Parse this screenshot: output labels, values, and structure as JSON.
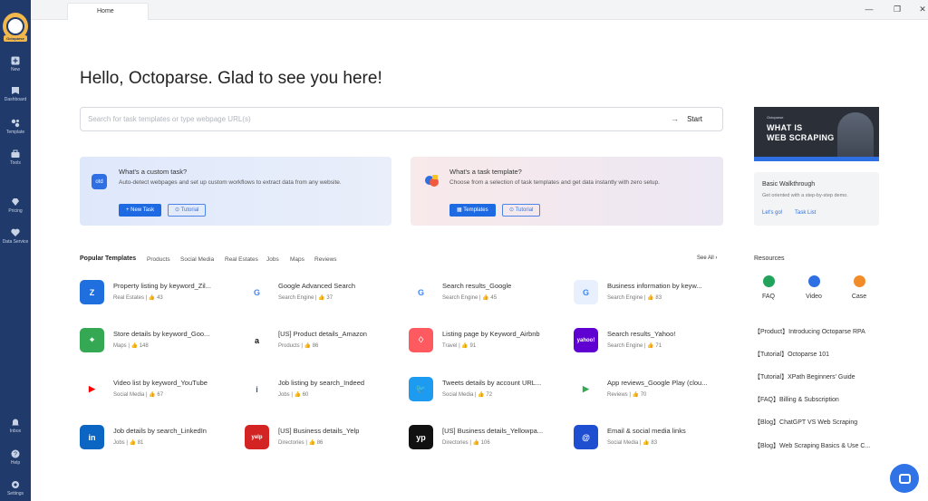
{
  "window": {
    "tab_label": "Home"
  },
  "sidebar": {
    "items": [
      {
        "label": "New",
        "icon": "plus-icon"
      },
      {
        "label": "Dashboard",
        "icon": "dashboard-icon"
      },
      {
        "label": "Template",
        "icon": "template-icon"
      },
      {
        "label": "Tools",
        "icon": "toolbox-icon"
      },
      {
        "label": "Pricing",
        "icon": "pricing-icon"
      },
      {
        "label": "Data Service",
        "icon": "data-service-icon"
      }
    ],
    "bottom_items": [
      {
        "label": "Inbox",
        "icon": "bell-icon"
      },
      {
        "label": "Help",
        "icon": "help-icon"
      },
      {
        "label": "Settings",
        "icon": "settings-icon"
      }
    ]
  },
  "main": {
    "greeting": "Hello, Octoparse. Glad to see you here!",
    "search": {
      "placeholder": "Search for task templates or type webpage URL(s)",
      "button_label": "Start"
    },
    "custom_card": {
      "title": "What's a custom task?",
      "description": "Auto-detect webpages and set up custom workflows to extract data from any website.",
      "primary_label": "+ New Task",
      "secondary_label": "Tutorial"
    },
    "template_card": {
      "title": "What's a task template?",
      "description": "Choose from a selection of task templates and get data instantly with zero setup.",
      "primary_label": "Templates",
      "secondary_label": "Tutorial"
    }
  },
  "popular": {
    "tabs": [
      "Popular Templates",
      "Products",
      "Social Media",
      "Real Estates",
      "Jobs",
      "Maps",
      "Reviews"
    ],
    "see_all": "See All",
    "templates": [
      {
        "name": "Property listing by keyword_Zil...",
        "category": "Real Estates",
        "likes": "43",
        "icon": "zillow-icon",
        "color": "#1f6fde",
        "glyph": "Z"
      },
      {
        "name": "Google Advanced Search",
        "category": "Search Engine",
        "likes": "37",
        "icon": "google-icon",
        "color": "#ffffff",
        "glyph": "G"
      },
      {
        "name": "Search results_Google",
        "category": "Search Engine",
        "likes": "45",
        "icon": "google-icon",
        "color": "#ffffff",
        "glyph": "G"
      },
      {
        "name": "Business information by keyw...",
        "category": "Search Engine",
        "likes": "83",
        "icon": "google-business-icon",
        "color": "#e8f0fd",
        "glyph": "G"
      },
      {
        "name": "Store details by keyword_Goo...",
        "category": "Maps",
        "likes": "148",
        "icon": "google-maps-icon",
        "color": "#34a853",
        "glyph": "⌖"
      },
      {
        "name": "[US] Product details_Amazon",
        "category": "Products",
        "likes": "86",
        "icon": "amazon-icon",
        "color": "#ffffff",
        "glyph": "a"
      },
      {
        "name": "Listing page by Keyword_Airbnb",
        "category": "Travel",
        "likes": "91",
        "icon": "airbnb-icon",
        "color": "#ff5a5f",
        "glyph": "♢"
      },
      {
        "name": "Search results_Yahoo!",
        "category": "Search Engine",
        "likes": "71",
        "icon": "yahoo-icon",
        "color": "#5f01d1",
        "glyph": "yahoo!"
      },
      {
        "name": "Video list by keyword_YouTube",
        "category": "Social Media",
        "likes": "67",
        "icon": "youtube-icon",
        "color": "#ffffff",
        "glyph": "▶"
      },
      {
        "name": "Job listing by search_Indeed",
        "category": "Jobs",
        "likes": "60",
        "icon": "indeed-icon",
        "color": "#ffffff",
        "glyph": "i"
      },
      {
        "name": "Tweets details by account URL...",
        "category": "Social Media",
        "likes": "72",
        "icon": "twitter-icon",
        "color": "#1d9bf0",
        "glyph": "🐦"
      },
      {
        "name": "App reviews_Google Play (clou...",
        "category": "Reviews",
        "likes": "70",
        "icon": "google-play-icon",
        "color": "#ffffff",
        "glyph": "▶"
      },
      {
        "name": "Job details by search_LinkedIn",
        "category": "Jobs",
        "likes": "81",
        "icon": "linkedin-icon",
        "color": "#0a66c2",
        "glyph": "in"
      },
      {
        "name": "[US] Business details_Yelp",
        "category": "Directories",
        "likes": "86",
        "icon": "yelp-icon",
        "color": "#d32323",
        "glyph": "yelp"
      },
      {
        "name": "[US] Business details_Yellowpa...",
        "category": "Directories",
        "likes": "106",
        "icon": "yellowpages-icon",
        "color": "#111111",
        "glyph": "yp"
      },
      {
        "name": "Email & social media links",
        "category": "Social Media",
        "likes": "83",
        "icon": "email-icon",
        "color": "#1f4fd1",
        "glyph": "@"
      }
    ]
  },
  "right": {
    "banner_lines": [
      "WHAT IS",
      "WEB SCRAPING"
    ],
    "banner_brand": "Octoparse",
    "walkthrough": {
      "title": "Basic Walkthrough",
      "description": "Get oriented with a step-by-step demo.",
      "link1": "Let's go!",
      "link2": "Task List"
    },
    "resources_title": "Resources",
    "resource_icons": [
      {
        "label": "FAQ",
        "icon": "faq-icon",
        "color": "#22a35b"
      },
      {
        "label": "Video",
        "icon": "video-icon",
        "color": "#2f6fe4"
      },
      {
        "label": "Case",
        "icon": "case-icon",
        "color": "#f28c28"
      }
    ],
    "links": [
      "【Product】Introducing Octoparse RPA",
      "【Tutorial】Octoparse 101",
      "【Tutorial】XPath Beginners' Guide",
      "【FAQ】Billing & Subscription",
      "【Blog】ChatGPT VS Web Scraping",
      "【Blog】Web Scraping Basics & Use C..."
    ]
  }
}
